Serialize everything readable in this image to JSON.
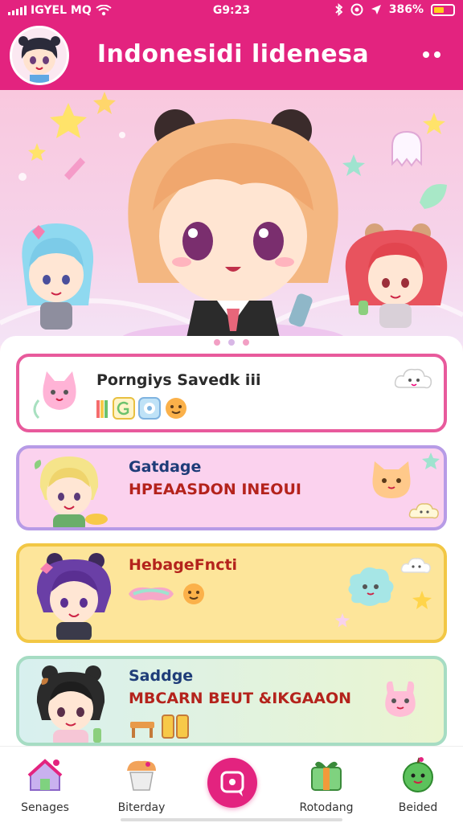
{
  "status_bar": {
    "carrier": "IGYEL MQ",
    "time": "G9:23",
    "battery_percent": "386%"
  },
  "app_bar": {
    "title": "Indonesidi lidenesa"
  },
  "banner": {
    "page_count": 3,
    "active_page": 2
  },
  "cards": [
    {
      "title": "Porngiys Savedk iii",
      "subtitle": ""
    },
    {
      "title": "Gatdage",
      "subtitle": "HPEAASDON INEOUI"
    },
    {
      "title": "HebageFncti",
      "subtitle": ""
    },
    {
      "title": "Saddge",
      "subtitle": "MBCARN BEUT &IKGAAON"
    }
  ],
  "tab_bar": {
    "tabs": [
      {
        "label": "Senages",
        "icon": "house-icon"
      },
      {
        "label": "Biterday",
        "icon": "cupcake-icon"
      },
      {
        "label": "",
        "icon": "chat-icon"
      },
      {
        "label": "Rotodang",
        "icon": "gift-icon"
      },
      {
        "label": "Beided",
        "icon": "apple-face-icon"
      }
    ]
  },
  "colors": {
    "primary": "#e3237f",
    "card1_border": "#e85a9c",
    "card2_border": "#b79be6",
    "card3_border": "#f2c744",
    "card4_border": "#a6dcc3"
  }
}
